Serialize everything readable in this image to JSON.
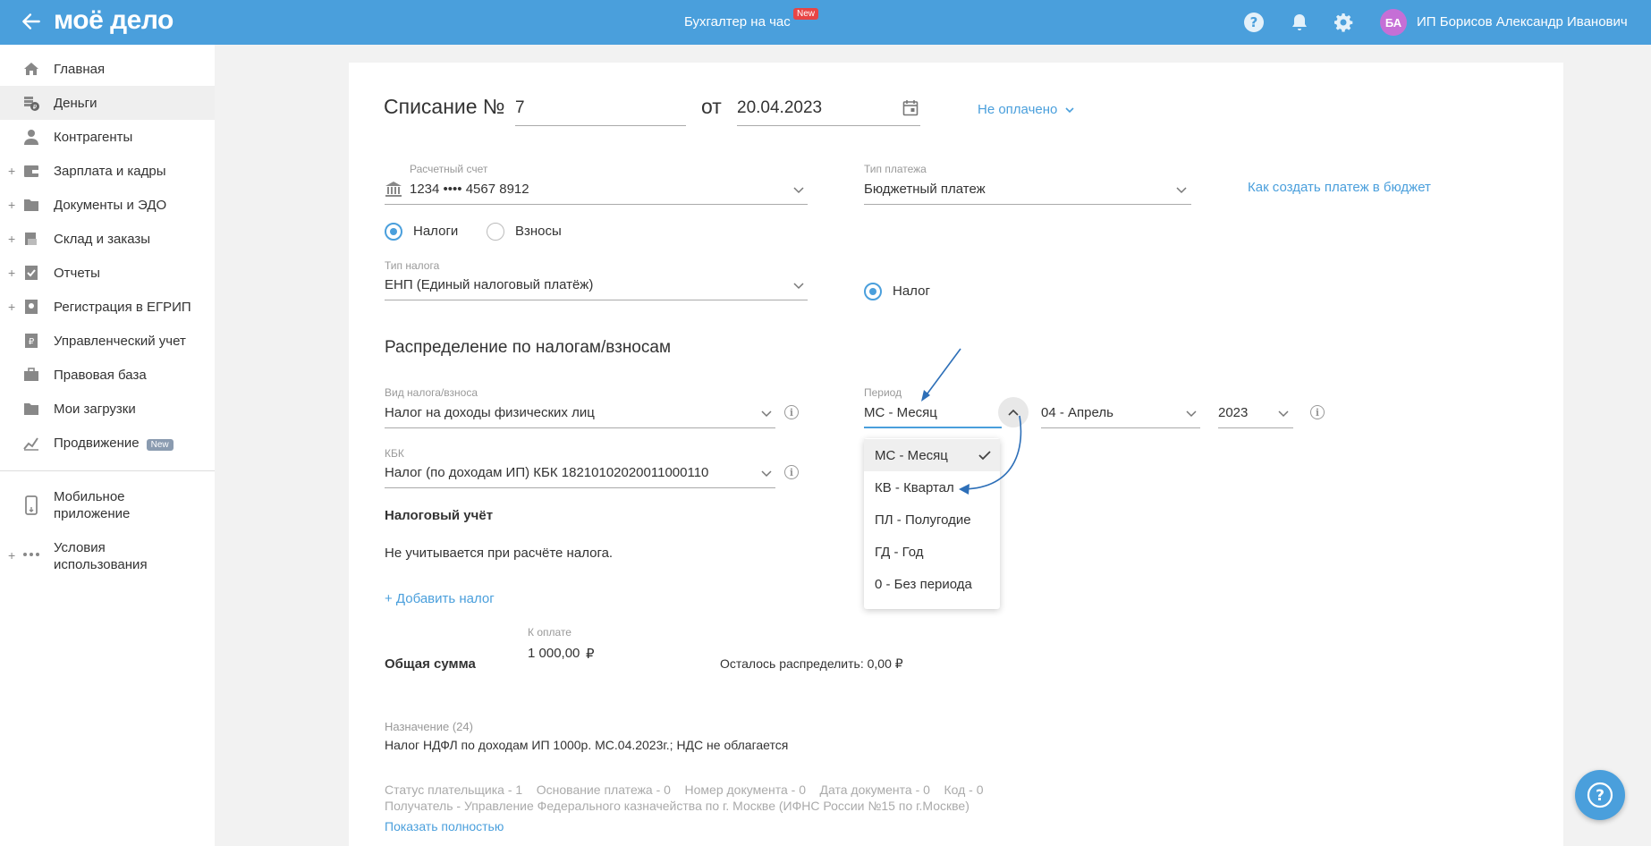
{
  "header": {
    "logo": "моё дело",
    "center_title": "Бухгалтер на час",
    "center_badge": "New",
    "avatar_initials": "БА",
    "user_name": "ИП Борисов Александр Иванович"
  },
  "sidebar": {
    "items": [
      {
        "label": "Главная"
      },
      {
        "label": "Деньги"
      },
      {
        "label": "Контрагенты"
      },
      {
        "label": "Зарплата и кадры"
      },
      {
        "label": "Документы и ЭДО"
      },
      {
        "label": "Склад и заказы"
      },
      {
        "label": "Отчеты"
      },
      {
        "label": "Регистрация в ЕГРИП"
      },
      {
        "label": "Управленческий учет"
      },
      {
        "label": "Правовая база"
      },
      {
        "label": "Мои загрузки"
      },
      {
        "label": "Продвижение",
        "badge": "New"
      },
      {
        "label": "Мобильное приложение"
      },
      {
        "label": "Условия использования"
      }
    ]
  },
  "form": {
    "title": "Списание №",
    "number": "7",
    "from_label": "от",
    "date": "20.04.2023",
    "status": "Не оплачено",
    "account_label": "Расчетный счет",
    "account_value": "1234 •••• 4567 8912",
    "payment_type_label": "Тип платежа",
    "payment_type_value": "Бюджетный платеж",
    "budget_help_link": "Как создать платеж в бюджет",
    "radio_taxes": "Налоги",
    "radio_contrib": "Взносы",
    "tax_type_label": "Тип налога",
    "tax_type_value": "ЕНП (Единый налоговый платёж)",
    "radio_tax": "Налог",
    "distribution_title": "Распределение по налогам/взносам",
    "kind_label": "Вид налога/взноса",
    "kind_value": "Налог на доходы физических лиц",
    "period_label": "Период",
    "period_value": "МС - Месяц",
    "month_value": "04 - Апрель",
    "year_value": "2023",
    "kbk_label": "КБК",
    "kbk_value": "Налог (по доходам ИП) КБК 18210102020011000110",
    "tax_accounting_title": "Налоговый учёт",
    "tax_accounting_text": "Не учитывается при расчёте налога.",
    "add_tax_link": "+ Добавить налог",
    "total_label": "Общая сумма",
    "to_pay_label": "К оплате",
    "to_pay_value": "1 000,00",
    "currency": "₽",
    "remaining": "Осталось распределить: 0,00 ₽",
    "purpose_label": "Назначение (24)",
    "purpose_value": "Налог НДФЛ по доходам ИП 1000р. МС.04.2023г.; НДС не облагается",
    "details_line1": "Статус плательщика - 1    Основание платежа - 0    Номер документа - 0    Дата документа - 0    Код - 0",
    "details_line2": "Получатель - Управление Федерального казначейства по г. Москве (ИФНС России №15 по г.Москве)",
    "show_full_link": "Показать полностью"
  },
  "period_dropdown": {
    "options": [
      "МС - Месяц",
      "КВ - Квартал",
      "ПЛ - Полугодие",
      "ГД - Год",
      "0 - Без периода"
    ],
    "selected": "МС - Месяц"
  },
  "colors": {
    "accent": "#4a9fdc",
    "header_bg": "#4a9fdc",
    "badge_red": "#e84545",
    "avatar": "#c56fd6"
  }
}
